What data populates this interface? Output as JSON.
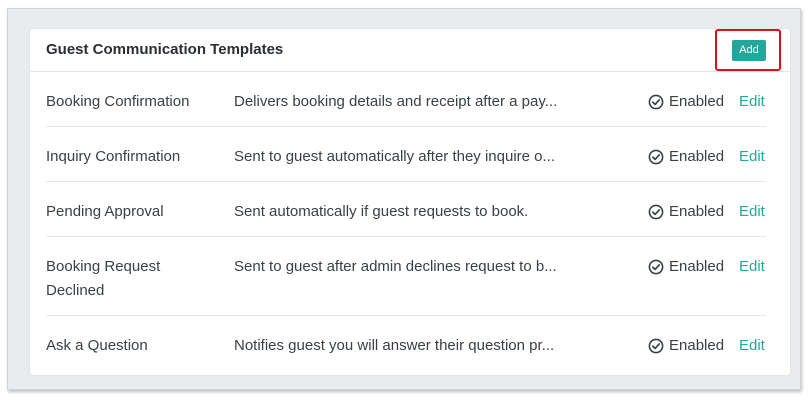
{
  "card": {
    "title": "Guest Communication Templates",
    "add_label": "Add"
  },
  "colors": {
    "accent": "#26a69a",
    "highlight": "#e0101b"
  },
  "templates": [
    {
      "name": "Booking Confirmation",
      "description": "Delivers booking details and receipt after a pay...",
      "status": "Enabled",
      "action": "Edit"
    },
    {
      "name": "Inquiry Confirmation",
      "description": "Sent to guest automatically after they inquire o...",
      "status": "Enabled",
      "action": "Edit"
    },
    {
      "name": "Pending Approval",
      "description": "Sent automatically if guest requests to book.",
      "status": "Enabled",
      "action": "Edit"
    },
    {
      "name": "Booking Request Declined",
      "description": "Sent to guest after admin declines request to b...",
      "status": "Enabled",
      "action": "Edit"
    },
    {
      "name": "Ask a Question",
      "description": "Notifies guest you will answer their question pr...",
      "status": "Enabled",
      "action": "Edit"
    }
  ]
}
